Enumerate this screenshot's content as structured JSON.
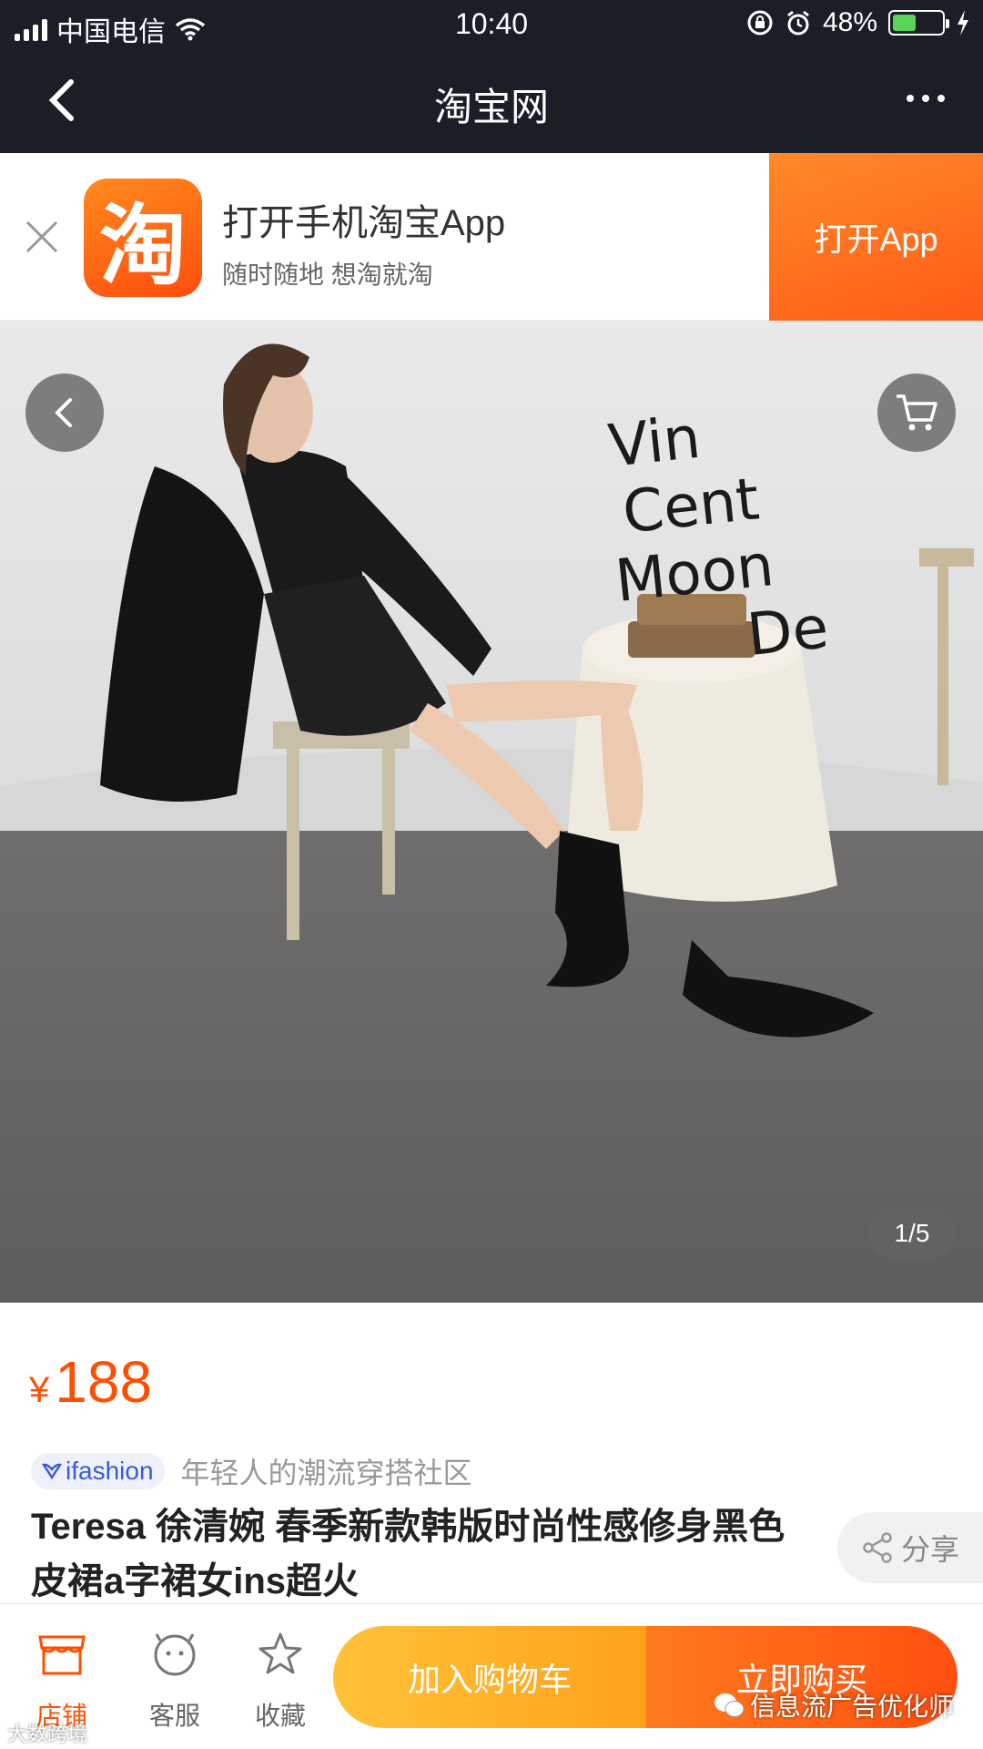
{
  "status_bar": {
    "carrier": "中国电信",
    "time": "10:40",
    "battery": "48%",
    "battery_level": 0.48
  },
  "nav": {
    "title": "淘宝网"
  },
  "app_banner": {
    "logo_char": "淘",
    "title": "打开手机淘宝App",
    "subtitle": "随时随地 想淘就淘",
    "open_button": "打开App",
    "accent_color": "#ff5a16"
  },
  "product_image": {
    "wall_text": [
      "Vin",
      "Cent",
      "Moon",
      "De"
    ],
    "counter": "1/5"
  },
  "product": {
    "currency": "¥",
    "price": "188",
    "brand": "ifashion",
    "brand_desc": "年轻人的潮流穿搭社区",
    "title": "Teresa 徐清婉 春季新款韩版时尚性感修身黑色皮裙a字裙女ins超火",
    "share": "分享"
  },
  "bottom_bar": {
    "shop": "店铺",
    "service": "客服",
    "favorite": "收藏",
    "add_to_cart": "加入购物车",
    "buy_now": "立即购买"
  },
  "watermarks": {
    "right": "信息流广告优化师",
    "left": "大数跨境"
  }
}
